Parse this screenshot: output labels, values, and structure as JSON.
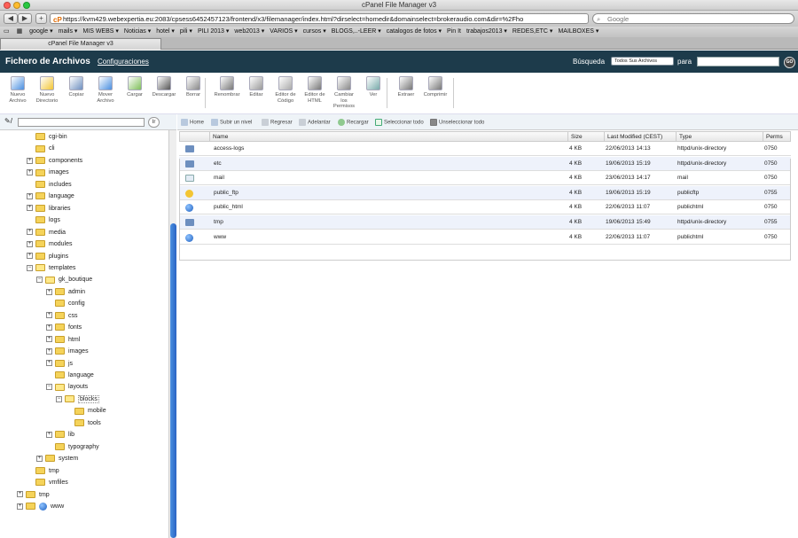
{
  "browser": {
    "window_title": "cPanel File Manager v3",
    "url": "https://kvm429.webexpertia.eu:2083/cpsess6452457123/frontend/x3/filemanager/index.html?dirselect=homedir&domainselect=brokeraudio.com&dir=%2Fho",
    "search_placeholder": "Google",
    "bookmarks": [
      "google ▾",
      "mails ▾",
      "MIS WEBS ▾",
      "Noticias ▾",
      "hotel ▾",
      "pili ▾",
      "PILI 2013 ▾",
      "web2013 ▾",
      "VARIOS ▾",
      "cursos ▾",
      "BLOGS,..-LEER ▾",
      "catalogos de fotos ▾",
      "Pin It",
      "trabajos2013 ▾",
      "REDES,ETC ▾",
      "MAILBOXES ▾"
    ],
    "tab_label": "cPanel File Manager v3"
  },
  "header": {
    "title": "Fichero de Archivos",
    "config_link": "Configuraciones",
    "search_label": "Búsqueda",
    "search_scope": "Todos Sus Archivos",
    "para_label": "para",
    "go_label": "GO"
  },
  "toolbar": [
    {
      "label": "Nuevo\nArchivo",
      "icon": "new-file-icon"
    },
    {
      "label": "Nuevo\nDirectorio",
      "icon": "new-folder-icon"
    },
    {
      "label": "Copiar",
      "icon": "copy-icon"
    },
    {
      "label": "Mover\nArchivo",
      "icon": "move-icon"
    },
    {
      "label": "Cargar",
      "icon": "upload-icon"
    },
    {
      "label": "Descargar",
      "icon": "download-icon"
    },
    {
      "label": "Borrar",
      "icon": "delete-icon"
    },
    {
      "label": "Renombrar",
      "icon": "rename-icon"
    },
    {
      "label": "Editar",
      "icon": "edit-icon"
    },
    {
      "label": "Editor de\nCódigo",
      "icon": "code-editor-icon"
    },
    {
      "label": "Editor de\nHTML",
      "icon": "html-editor-icon"
    },
    {
      "label": "Cambiar\nlos\nPermisos",
      "icon": "permissions-icon"
    },
    {
      "label": "Ver",
      "icon": "view-icon"
    },
    {
      "label": "Extraer",
      "icon": "extract-icon"
    },
    {
      "label": "Comprimir",
      "icon": "compress-icon"
    }
  ],
  "tree": {
    "go_label": "Ir",
    "nodes": [
      {
        "label": "cgi-bin",
        "expand": ""
      },
      {
        "label": "cli",
        "expand": ""
      },
      {
        "label": "components",
        "expand": "+"
      },
      {
        "label": "images",
        "expand": "+"
      },
      {
        "label": "includes",
        "expand": ""
      },
      {
        "label": "language",
        "expand": "+"
      },
      {
        "label": "libraries",
        "expand": "+"
      },
      {
        "label": "logs",
        "expand": ""
      },
      {
        "label": "media",
        "expand": "+"
      },
      {
        "label": "modules",
        "expand": "+"
      },
      {
        "label": "plugins",
        "expand": "+"
      },
      {
        "label": "templates",
        "expand": "−"
      },
      {
        "label": "gk_boutique",
        "expand": "−"
      },
      {
        "label": "admin",
        "expand": "+"
      },
      {
        "label": "config",
        "expand": ""
      },
      {
        "label": "css",
        "expand": "+"
      },
      {
        "label": "fonts",
        "expand": "+"
      },
      {
        "label": "html",
        "expand": "+"
      },
      {
        "label": "images",
        "expand": "+"
      },
      {
        "label": "js",
        "expand": "+"
      },
      {
        "label": "language",
        "expand": ""
      },
      {
        "label": "layouts",
        "expand": "−"
      },
      {
        "label": "blocks",
        "expand": "−"
      },
      {
        "label": "mobile",
        "expand": ""
      },
      {
        "label": "tools",
        "expand": ""
      },
      {
        "label": "lib",
        "expand": "+"
      },
      {
        "label": "typography",
        "expand": ""
      },
      {
        "label": "system",
        "expand": "+"
      },
      {
        "label": "tmp",
        "expand": ""
      },
      {
        "label": "vmfiles",
        "expand": ""
      },
      {
        "label": "tmp",
        "expand": "+"
      },
      {
        "label": "www",
        "expand": "+"
      }
    ]
  },
  "filenav": {
    "home": "Home",
    "up": "Subir un nivel",
    "back": "Regresar",
    "forward": "Adelantar",
    "reload": "Recargar",
    "select_all": "Seleccionar todo",
    "unselect_all": "Unseleccionar todo"
  },
  "columns": [
    "Name",
    "Size",
    "Last Modified (CEST)",
    "Type",
    "Perms"
  ],
  "files": [
    {
      "icon": "folder",
      "name": "access-logs",
      "size": "4 KB",
      "modified": "22/06/2013 14:13",
      "type": "httpd/unix-directory",
      "perms": "0750"
    },
    {
      "icon": "folder",
      "name": "etc",
      "size": "4 KB",
      "modified": "19/06/2013 15:19",
      "type": "httpd/unix-directory",
      "perms": "0750"
    },
    {
      "icon": "mail",
      "name": "mail",
      "size": "4 KB",
      "modified": "23/06/2013 14:17",
      "type": "mail",
      "perms": "0750"
    },
    {
      "icon": "ftp",
      "name": "public_ftp",
      "size": "4 KB",
      "modified": "19/06/2013 15:19",
      "type": "publicftp",
      "perms": "0755"
    },
    {
      "icon": "globe",
      "name": "public_html",
      "size": "4 KB",
      "modified": "22/06/2013 11:07",
      "type": "publichtml",
      "perms": "0750"
    },
    {
      "icon": "folder",
      "name": "tmp",
      "size": "4 KB",
      "modified": "19/06/2013 15:49",
      "type": "httpd/unix-directory",
      "perms": "0755"
    },
    {
      "icon": "globe",
      "name": "www",
      "size": "4 KB",
      "modified": "22/06/2013 11:07",
      "type": "publichtml",
      "perms": "0750"
    }
  ]
}
